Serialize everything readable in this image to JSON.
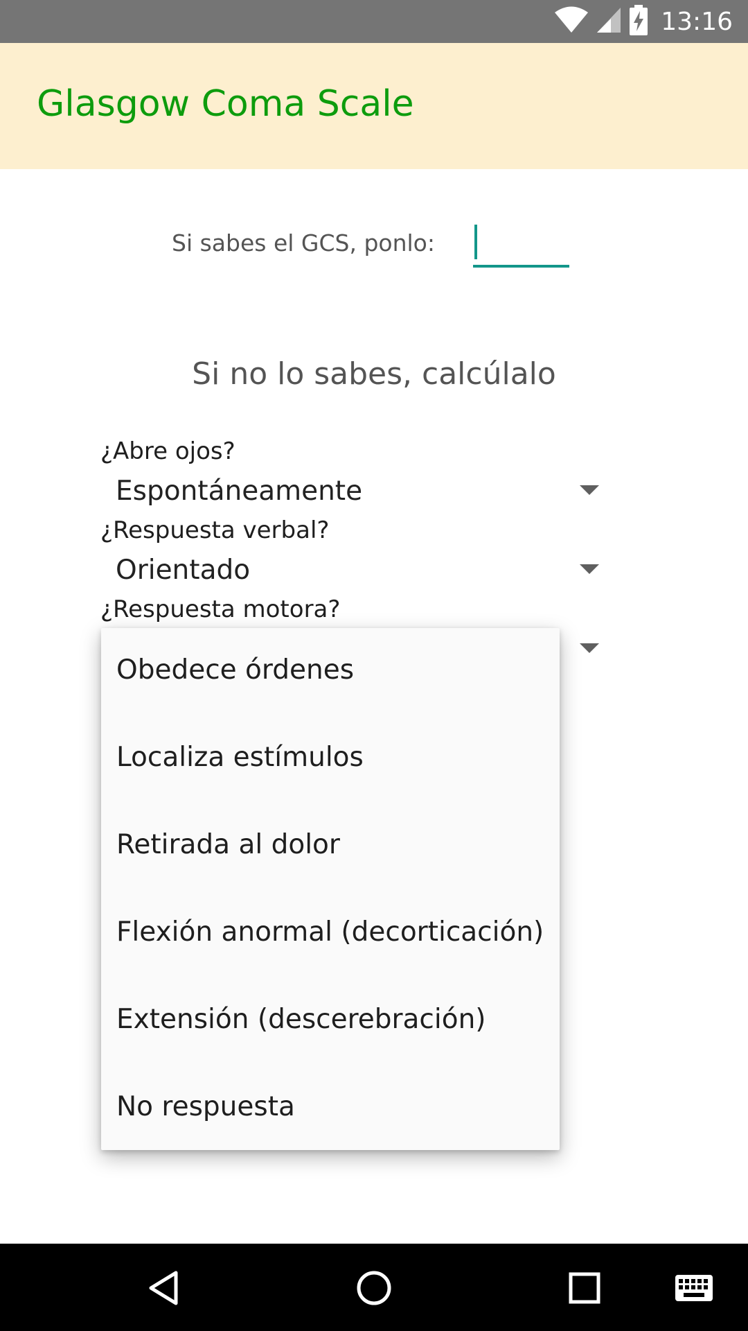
{
  "status_bar": {
    "time": "13:16",
    "icons": [
      "wifi-icon",
      "cell-signal-icon",
      "battery-charging-icon"
    ]
  },
  "app_bar": {
    "title": "Glasgow Coma Scale",
    "background_color": "#fdefcf",
    "title_color": "#0d9c0d"
  },
  "gcs_input": {
    "label": "Si sabes el GCS, ponlo:",
    "value": "",
    "accent_color": "#13968a"
  },
  "calc_heading": "Si no lo sabes, calcúlalo",
  "questions": {
    "eyes": {
      "label": "¿Abre ojos?",
      "selected": "Espontáneamente"
    },
    "verbal": {
      "label": "¿Respuesta verbal?",
      "selected": "Orientado"
    },
    "motor": {
      "label": "¿Respuesta motora?",
      "options": [
        "Obedece órdenes",
        "Localiza estímulos",
        "Retirada al dolor",
        "Flexión anormal (decorticación)",
        "Extensión (descerebración)",
        "No respuesta"
      ]
    }
  },
  "nav_bar": {
    "buttons": [
      "back-icon",
      "home-icon",
      "recents-icon",
      "keyboard-icon"
    ]
  }
}
